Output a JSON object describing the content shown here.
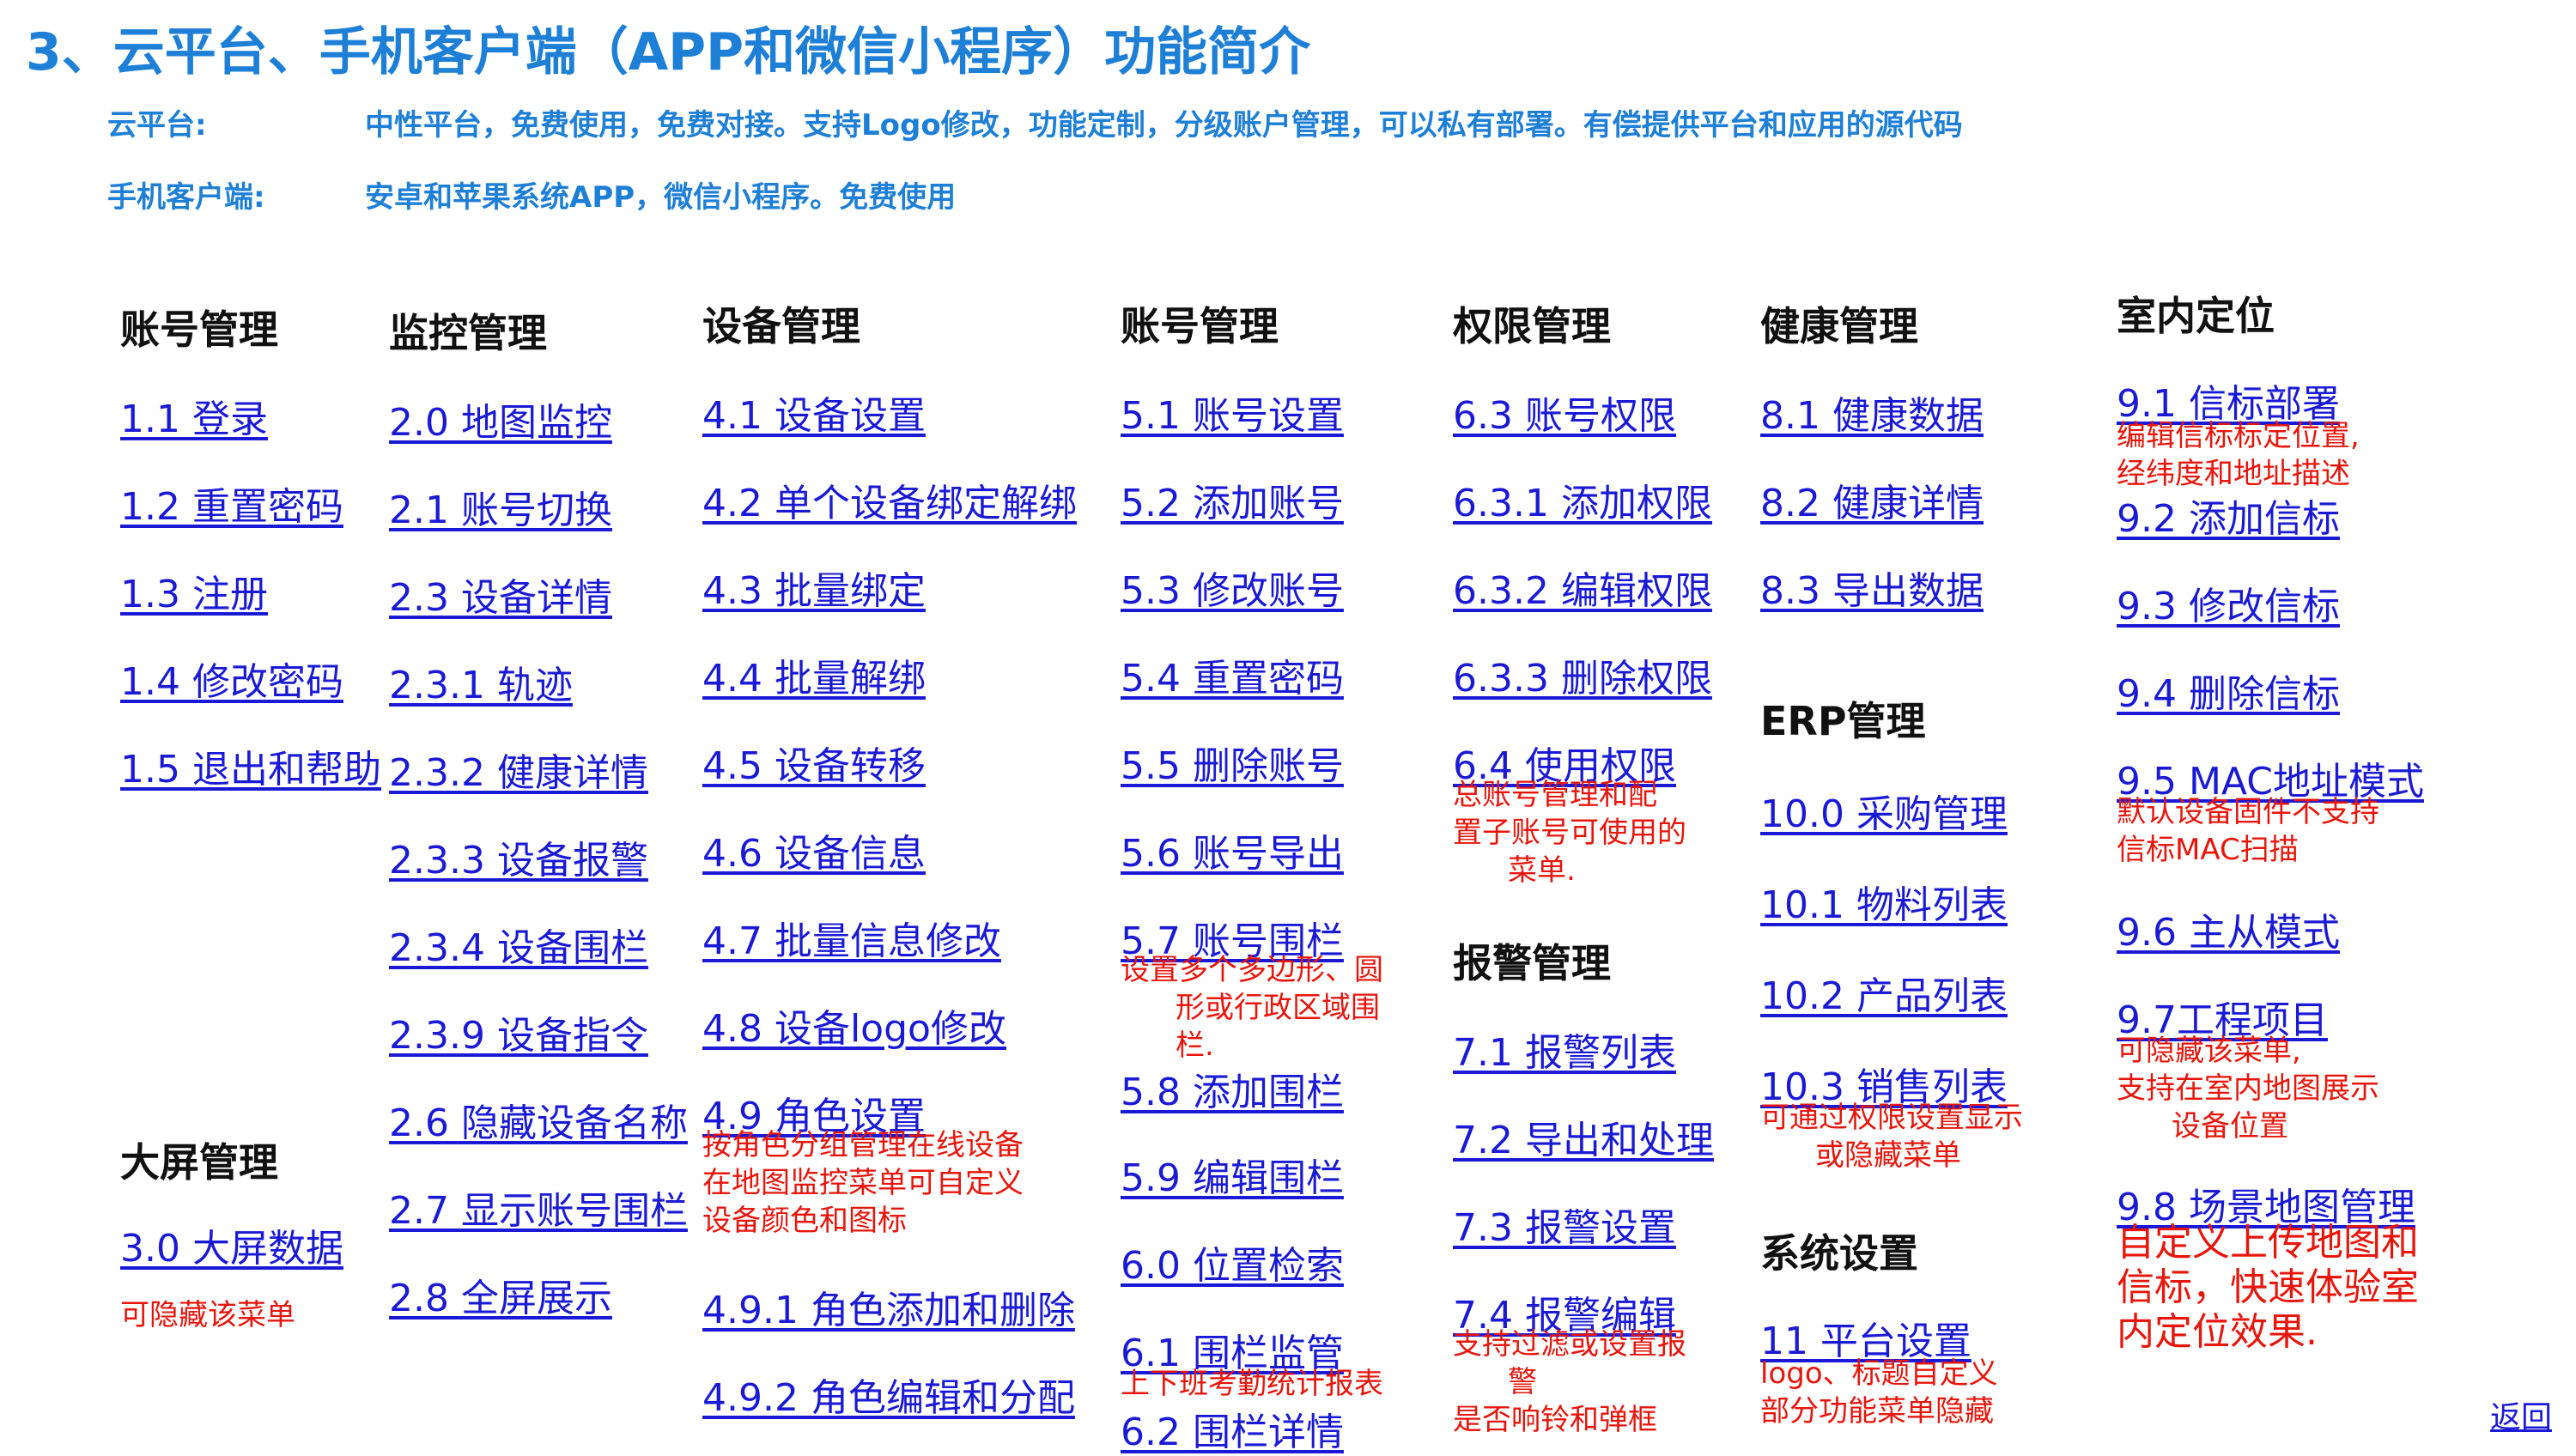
{
  "title": "3、云平台、手机客户端（APP和微信小程序）功能简介",
  "info": {
    "cloud_label": "云平台:",
    "cloud_text": "中性平台，免费使用，免费对接。支持Logo修改，功能定制，分级账户管理，可以私有部署。有偿提供平台和应用的源代码",
    "mobile_label": "手机客户端:",
    "mobile_text": "安卓和苹果系统APP，微信小程序。免费使用"
  },
  "headings": {
    "account1": "账号管理",
    "monitor": "监控管理",
    "device": "设备管理",
    "account2": "账号管理",
    "permission": "权限管理",
    "health": "健康管理",
    "indoor": "室内定位",
    "bigscreen": "大屏管理",
    "alarm": "报警管理",
    "erp": "ERP管理",
    "system": "系统设置"
  },
  "col1": [
    "1.1 登录",
    "1.2 重置密码",
    "1.3 注册",
    "1.4 修改密码",
    "1.5 退出和帮助"
  ],
  "bigscreen": {
    "link": "3.0 大屏数据",
    "note": "可隐藏该菜单"
  },
  "col2": [
    "2.0 地图监控",
    "2.1 账号切换",
    "2.3 设备详情",
    "2.3.1 轨迹",
    "2.3.2 健康详情",
    "2.3.3 设备报警",
    "2.3.4 设备围栏",
    "2.3.9 设备指令",
    "2.6 隐藏设备名称",
    "2.7 显示账号围栏",
    "2.8 全屏展示"
  ],
  "col3": [
    "4.1 设备设置",
    "4.2 单个设备绑定解绑",
    "4.3 批量绑定",
    "4.4 批量解绑",
    "4.5 设备转移",
    "4.6 设备信息",
    "4.7 批量信息修改",
    "4.8 设备logo修改",
    "4.9 角色设置",
    "4.9.1 角色添加和删除",
    "4.9.2 角色编辑和分配"
  ],
  "col3_note": [
    "按角色分组管理在线设备",
    "在地图监控菜单可自定义",
    "设备颜色和图标"
  ],
  "col4": [
    "5.1 账号设置",
    "5.2 添加账号",
    "5.3 修改账号",
    "5.4 重置密码",
    "5.5 删除账号",
    "5.6 账号导出",
    "5.7 账号围栏",
    "5.8 添加围栏",
    "5.9 编辑围栏",
    "6.0 位置检索",
    "6.1 围栏监管",
    "6.2 围栏详情"
  ],
  "col4_note1": [
    "设置多个多边形、圆",
    "形或行政区域围",
    "栏."
  ],
  "col4_note2": "上下班考勤统计报表",
  "col5": [
    "6.3 账号权限",
    "6.3.1 添加权限",
    "6.3.2 编辑权限",
    "6.3.3 删除权限",
    "6.4 使用权限",
    "7.1 报警列表",
    "7.2 导出和处理",
    "7.3 报警设置",
    "7.4 报警编辑"
  ],
  "col5_note1": [
    "总账号管理和配",
    "置子账号可使用的",
    "菜单."
  ],
  "col5_note2": [
    "支持过滤或设置报",
    "警",
    "是否响铃和弹框"
  ],
  "col6": [
    "8.1 健康数据",
    "8.2 健康详情",
    "8.3 导出数据",
    "10.0 采购管理",
    "10.1 物料列表",
    "10.2 产品列表",
    "10.3 销售列表",
    "11 平台设置"
  ],
  "col6_note1": [
    "可通过权限设置显示",
    "或隐藏菜单"
  ],
  "col6_note2": [
    "logo、标题自定义",
    "部分功能菜单隐藏"
  ],
  "col7": [
    "9.1 信标部署",
    "9.2 添加信标",
    "9.3 修改信标",
    "9.4 删除信标",
    "9.5 MAC地址模式",
    "9.6 主从模式",
    "9.7工程项目",
    "9.8 场景地图管理"
  ],
  "col7_note1": [
    "编辑信标标定位置,",
    "经纬度和地址描述"
  ],
  "col7_note2": [
    "默认设备固件不支持",
    "信标MAC扫描"
  ],
  "col7_note3": [
    "可隐藏该菜单,",
    "支持在室内地图展示",
    "设备位置"
  ],
  "col7_note4": [
    "自定义上传地图和",
    "信标，快速体验室",
    "内定位效果."
  ],
  "back": "返回",
  "colors": {
    "title": "#1e7fd6",
    "link": "#1a1ad6",
    "note": "#e8150b",
    "heading": "#111111"
  }
}
